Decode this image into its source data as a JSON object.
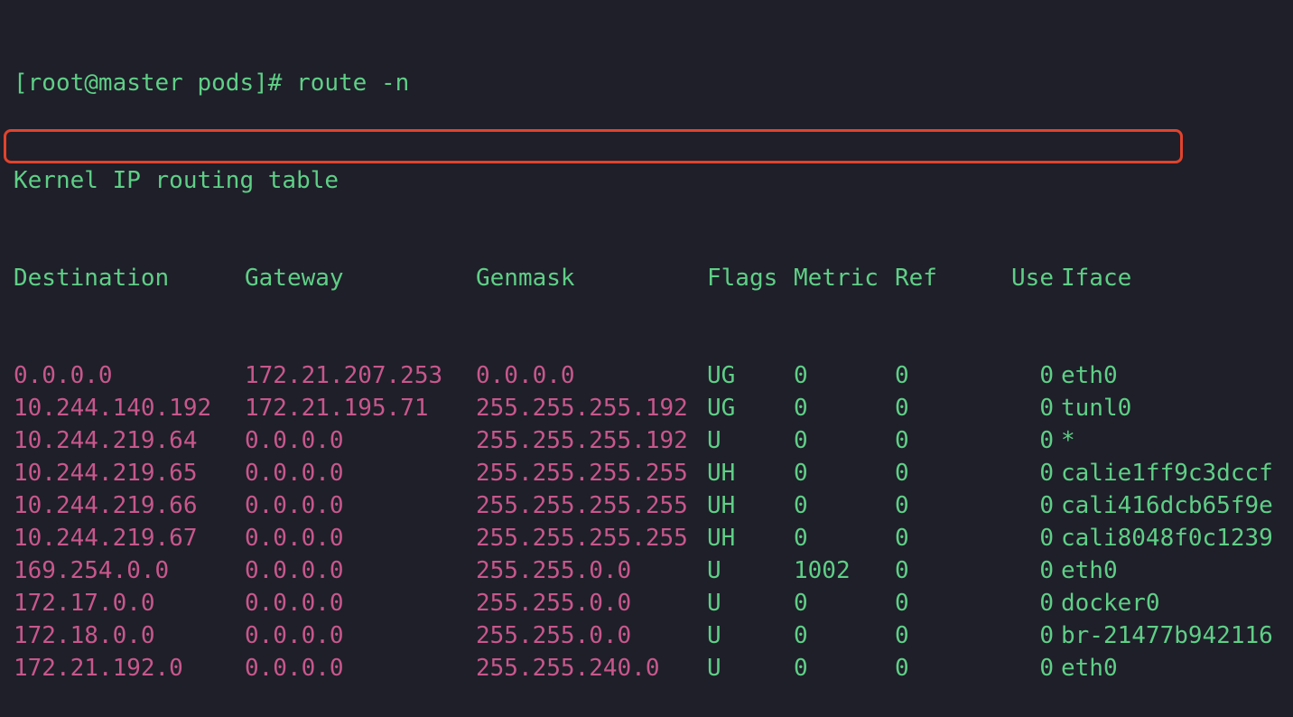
{
  "prompt": "[root@master pods]# route -n",
  "title": "Kernel IP routing table",
  "headers": {
    "destination": "Destination",
    "gateway": "Gateway",
    "genmask": "Genmask",
    "flags": "Flags",
    "metric": "Metric",
    "ref": "Ref",
    "use": "Use",
    "iface": "Iface"
  },
  "routes": [
    {
      "destination": "0.0.0.0",
      "gateway": "172.21.207.253",
      "genmask": "0.0.0.0",
      "flags": "UG",
      "metric": "0",
      "ref": "0",
      "use": "0",
      "iface": "eth0"
    },
    {
      "destination": "10.244.140.192",
      "gateway": "172.21.195.71",
      "genmask": "255.255.255.192",
      "flags": "UG",
      "metric": "0",
      "ref": "0",
      "use": "0",
      "iface": "tunl0"
    },
    {
      "destination": "10.244.219.64",
      "gateway": "0.0.0.0",
      "genmask": "255.255.255.192",
      "flags": "U",
      "metric": "0",
      "ref": "0",
      "use": "0",
      "iface": "*"
    },
    {
      "destination": "10.244.219.65",
      "gateway": "0.0.0.0",
      "genmask": "255.255.255.255",
      "flags": "UH",
      "metric": "0",
      "ref": "0",
      "use": "0",
      "iface": "calie1ff9c3dccf"
    },
    {
      "destination": "10.244.219.66",
      "gateway": "0.0.0.0",
      "genmask": "255.255.255.255",
      "flags": "UH",
      "metric": "0",
      "ref": "0",
      "use": "0",
      "iface": "cali416dcb65f9e"
    },
    {
      "destination": "10.244.219.67",
      "gateway": "0.0.0.0",
      "genmask": "255.255.255.255",
      "flags": "UH",
      "metric": "0",
      "ref": "0",
      "use": "0",
      "iface": "cali8048f0c1239"
    },
    {
      "destination": "169.254.0.0",
      "gateway": "0.0.0.0",
      "genmask": "255.255.0.0",
      "flags": "U",
      "metric": "1002",
      "ref": "0",
      "use": "0",
      "iface": "eth0"
    },
    {
      "destination": "172.17.0.0",
      "gateway": "0.0.0.0",
      "genmask": "255.255.0.0",
      "flags": "U",
      "metric": "0",
      "ref": "0",
      "use": "0",
      "iface": "docker0"
    },
    {
      "destination": "172.18.0.0",
      "gateway": "0.0.0.0",
      "genmask": "255.255.0.0",
      "flags": "U",
      "metric": "0",
      "ref": "0",
      "use": "0",
      "iface": "br-21477b942116"
    },
    {
      "destination": "172.21.192.0",
      "gateway": "0.0.0.0",
      "genmask": "255.255.240.0",
      "flags": "U",
      "metric": "0",
      "ref": "0",
      "use": "0",
      "iface": "eth0"
    }
  ],
  "colors": {
    "background": "#1e1f29",
    "green": "#5fcf86",
    "pink": "#c8578c",
    "highlight": "#e1432c"
  }
}
